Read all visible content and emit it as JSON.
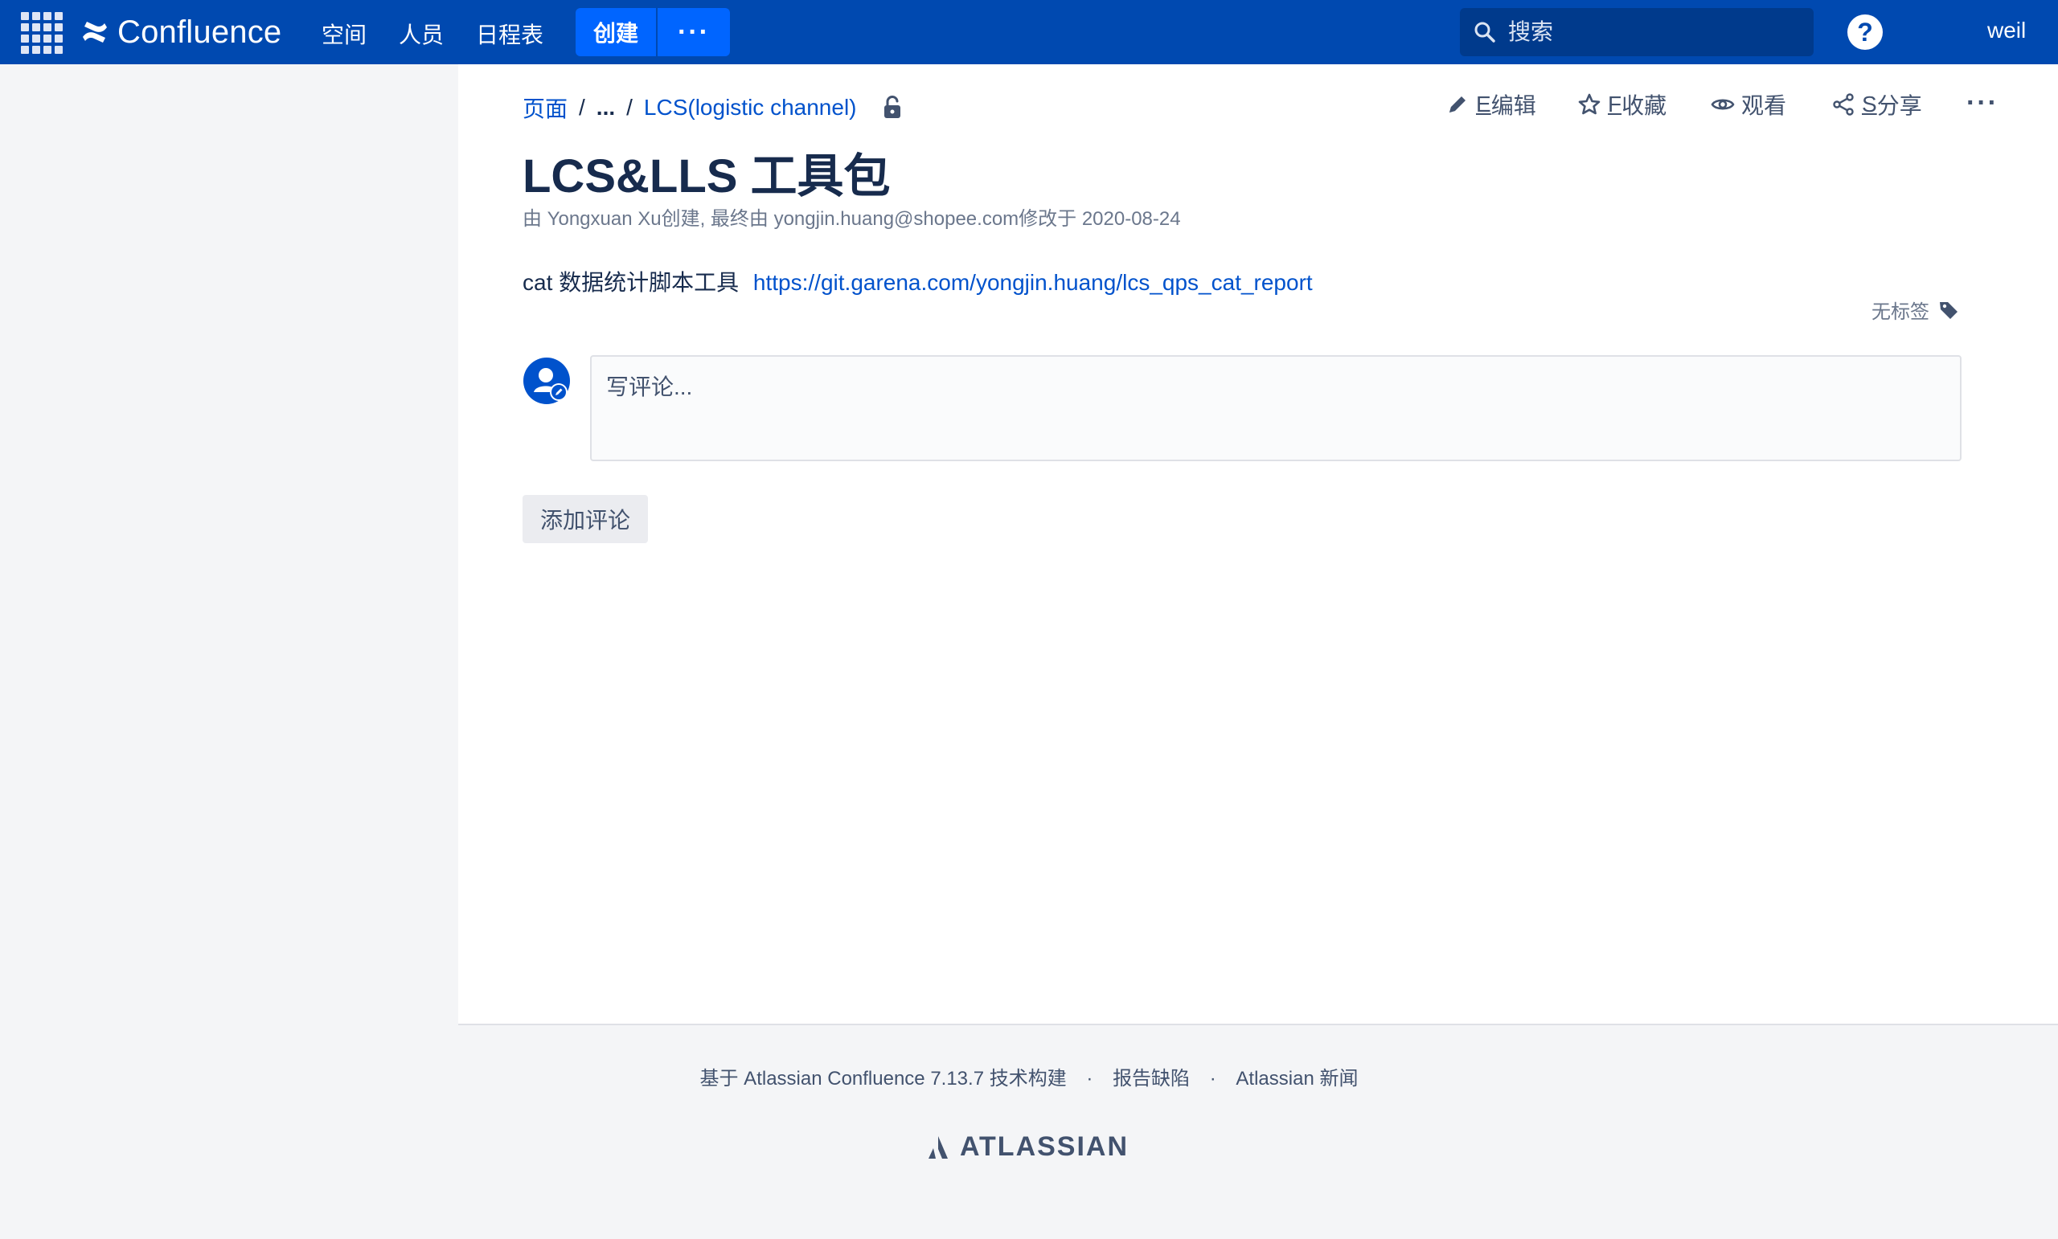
{
  "header": {
    "brand": "Confluence",
    "nav": [
      "空间",
      "人员",
      "日程表"
    ],
    "create_label": "创建",
    "more_label": "···",
    "search_placeholder": "搜索",
    "help_label": "?",
    "user_name": "weil"
  },
  "breadcrumb": {
    "root": "页面",
    "ellipsis": "...",
    "parent": "LCS(logistic channel)"
  },
  "actions": {
    "edit_key": "E",
    "edit_label": "编辑",
    "star_key": "F",
    "star_label": "收藏",
    "watch_label": "观看",
    "share_key": "S",
    "share_label": "分享",
    "more_label": "···"
  },
  "page": {
    "title": "LCS&LLS 工具包",
    "byline": "由 Yongxuan Xu创建, 最终由 yongjin.huang@shopee.com修改于 2020-08-24",
    "content_text": "cat 数据统计脚本工具",
    "content_link": "https://git.garena.com/yongjin.huang/lcs_qps_cat_report",
    "labels_text": "无标签"
  },
  "comment": {
    "placeholder": "写评论...",
    "add_button": "添加评论"
  },
  "footer": {
    "powered_by": "基于 Atlassian Confluence 7.13.7 技术构建",
    "report_bug": "报告缺陷",
    "news": "Atlassian 新闻",
    "brand": "ATLASSIAN"
  },
  "colors": {
    "header_bg": "#0049b0",
    "create_bg": "#0065ff",
    "link": "#0052cc",
    "text": "#172b4d"
  }
}
